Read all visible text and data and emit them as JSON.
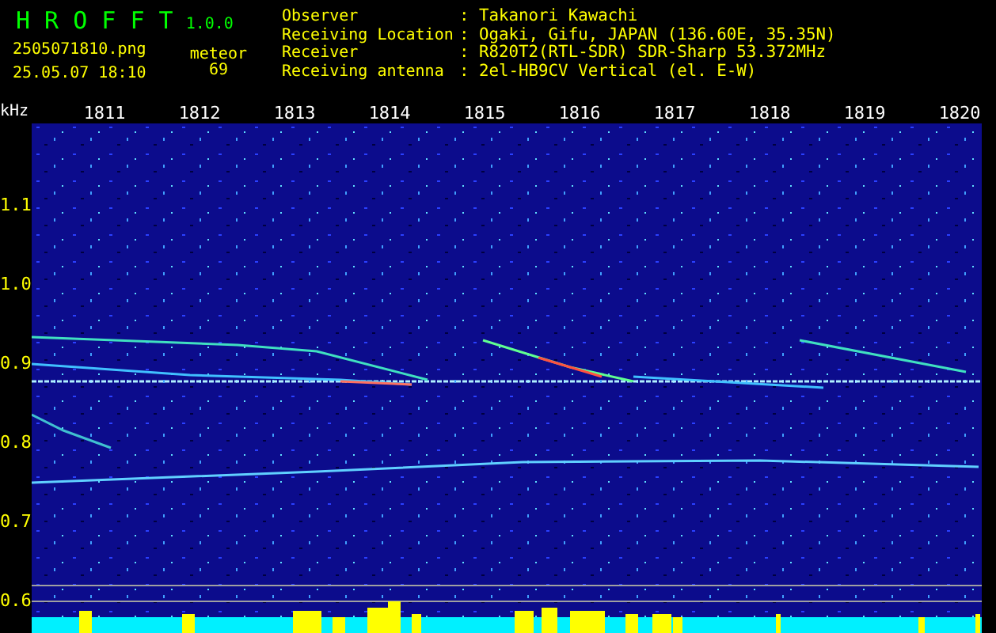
{
  "app": {
    "title": "H R O F F T",
    "version": "1.0.0",
    "filename": "2505071810.png",
    "datetime": "25.05.07 18:10",
    "count_label": "meteor",
    "count": "69"
  },
  "info": [
    {
      "label": "Observer",
      "value": ": Takanori Kawachi"
    },
    {
      "label": "Receiving Location",
      "value": ": Ogaki, Gifu, JAPAN (136.60E, 35.35N)"
    },
    {
      "label": "Receiver",
      "value": ": R820T2(RTL-SDR) SDR-Sharp 53.372MHz"
    },
    {
      "label": "Receiving antenna",
      "value": ": 2el-HB9CV Vertical (el. E-W)"
    }
  ],
  "y_axis": {
    "unit": "kHz",
    "labels": [
      "1.1",
      "1.0",
      "0.9",
      "0.8",
      "0.7",
      "0.6"
    ]
  },
  "x_axis": {
    "labels": [
      "1811",
      "1812",
      "1813",
      "1814",
      "1815",
      "1816",
      "1817",
      "1818",
      "1819",
      "1820"
    ]
  }
}
